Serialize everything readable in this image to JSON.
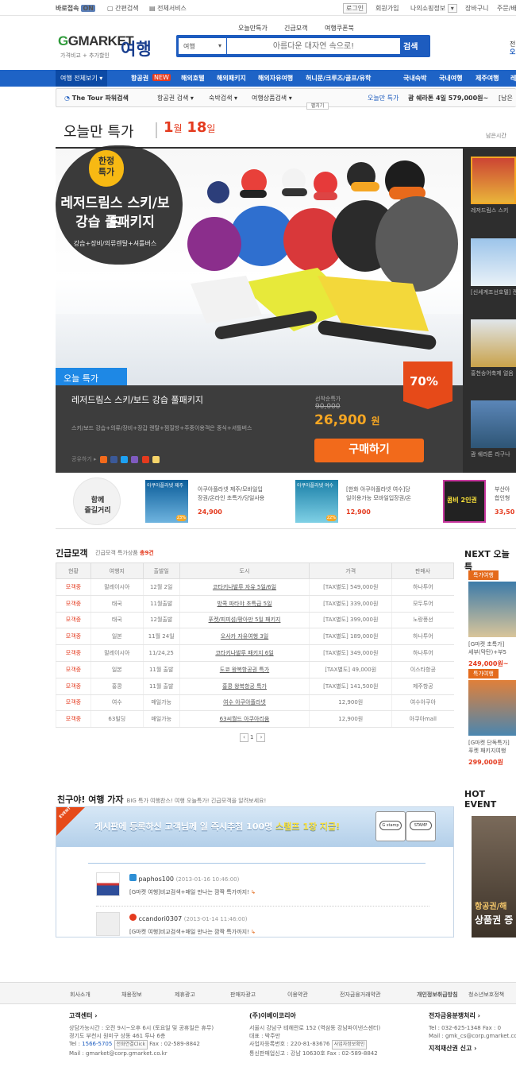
{
  "topbar": {
    "quick_access": "바로접속",
    "on_badge": "ON",
    "simple_search": "간편검색",
    "all_services": "전체서비스",
    "login": "로그인",
    "join": "회원가입",
    "my_shopping": "나의쇼핑정보",
    "cart": "장바구니",
    "order": "주문/배"
  },
  "header": {
    "logo_main": "GMARKET",
    "logo_sub": "가격비교 + 추가할인",
    "logo_travel": "여행",
    "links": [
      "오늘만특가",
      "긴급모객",
      "여행쿠폰북"
    ],
    "search_select": "여행",
    "search_placeholder": "아름다운 대자연 속으로!",
    "search_button": "검색",
    "right_cut": "전",
    "right_cut2": "오"
  },
  "nav": {
    "all_travel": "여행 전체보기",
    "items": [
      "항공권",
      "해외호텔",
      "해외패키지",
      "해외자유여행",
      "허니문/크루즈/골프/유학",
      "국내숙박",
      "국내여행",
      "제주여행",
      "레"
    ],
    "new_badge": "NEW"
  },
  "subnav": {
    "thetour": "The Tour 파워검색",
    "items": [
      "항공권 검색",
      "숙박검색",
      "여행상품검색"
    ],
    "today_label": "오늘만 특가",
    "today_deal": "괌 쉐라톤 4일 579,000원~",
    "today_tail": "[남은",
    "folder": "펼치기"
  },
  "today": {
    "title": "오늘만 특가",
    "month": "1",
    "month_unit": "월",
    "day": "18",
    "day_unit": "일",
    "remain": "남은시간"
  },
  "hero": {
    "badge_top": "한정",
    "badge_top2": "특가",
    "title1": "레저드림스 스키/보드",
    "title2": "강습 풀패키지",
    "tagline": "강습+장비/의류렌탈+셔틀버스",
    "tab": "오늘 특가",
    "discount": "70%",
    "name": "레저드림스 스키/보드 강습 풀패키지",
    "desc": "스키/보드 강습+의류/장비+장갑 렌탈+찜질방+주중이용객은 중식+셔틀버스",
    "share_label": "공유하기",
    "price_label": "선착순특가",
    "original_price": "90,000",
    "price": "26,900",
    "price_unit": "원",
    "buy": "구매하기"
  },
  "thumbs": [
    {
      "caption": "레저드림스 스키"
    },
    {
      "caption": "[신세계조선호텔] 켄"
    },
    {
      "caption": "홍천송어축제 얼음"
    },
    {
      "caption": "괌 쉐라톤 라구나"
    }
  ],
  "together": {
    "title1": "함께",
    "title2": "즐길거리",
    "items": [
      {
        "tag": "아쿠아플라넷 제주",
        "line1": "아쿠아플라넷 제주/모바일입",
        "line2": "장권/온라인 초특가/당일사용",
        "price": "24,900",
        "pct": "23%"
      },
      {
        "tag": "아쿠아플라넷 여수",
        "line1": "[한화 아쿠아플라넷 여수]당",
        "line2": "일이용가능 모바일입장권/온",
        "price": "12,900",
        "pct": "22%"
      },
      {
        "tag": "콤비 2인권",
        "line1": "부산아",
        "line2": "합인형",
        "price": "33,50",
        "pct": ""
      }
    ]
  },
  "urgent": {
    "title": "긴급모객",
    "subtitle": "긴급모객 특가상품",
    "total_prefix": "총",
    "total_count": "9건",
    "headers": [
      "현황",
      "여행지",
      "출발일",
      "도시",
      "가격",
      "판매사"
    ],
    "rows": [
      [
        "모객중",
        "말레이시아",
        "12월 2일",
        "코타키나발루 자유 5일/6일",
        "[TAX별도] 549,000원",
        "하나투어"
      ],
      [
        "모객중",
        "태국",
        "11월출발",
        "방콕 파타야 초특급 5일",
        "[TAX별도] 339,000원",
        "모두투어"
      ],
      [
        "모객중",
        "태국",
        "12월출발",
        "푸켓/피피섬/팡아만 5일 패키지",
        "[TAX별도] 399,000원",
        "노랑풍선"
      ],
      [
        "모객중",
        "일본",
        "11월 24일",
        "오사카 자유여행 3일",
        "[TAX별도] 189,000원",
        "하나투어"
      ],
      [
        "모객중",
        "말레이시아",
        "11/24,25",
        "코타키나발루 패키지 6일",
        "[TAX별도] 349,000원",
        "하나투어"
      ],
      [
        "모객중",
        "일본",
        "11월 출발",
        "도쿄 왕복항공권 특가",
        "[TAX별도] 49,000원",
        "이스타항공"
      ],
      [
        "모객중",
        "홍콩",
        "11월 출발",
        "홍콩 왕복항공 특가",
        "[TAX별도] 141,500원",
        "제주항공"
      ],
      [
        "모객중",
        "여수",
        "매일가능",
        "여수 아쿠아플라넷",
        "12,900원",
        "여수아쿠아"
      ],
      [
        "모객중",
        "63빌딩",
        "매일가능",
        "63씨월드 아쿠아리움",
        "12,900원",
        "아쿠아mall"
      ]
    ],
    "page": "1"
  },
  "next": {
    "title": "NEXT 오늘특",
    "items": [
      {
        "tag": "특가여행",
        "line1": "[G마켓 초특가]",
        "line2": "세부(막탄)+부5",
        "price": "249,000원~"
      },
      {
        "tag": "특가여행",
        "line1": "[G마켓 단독특가]",
        "line2": "푸켓 패키지여행",
        "price": "299,000원"
      }
    ]
  },
  "friend": {
    "title": "친구야! 여행 가자",
    "subtitle": "BIG 특가 여행찬스! 여행 오늘특가! 긴급모객을 알려보세요!",
    "event_tag": "EVENT",
    "banner_text": "게시판에 등록하신 고객님께 일 즉시추첨 100명",
    "banner_highlight": "스탬프 1장 지급!",
    "stamp1": "G stamp",
    "stamp2": "STAMP",
    "comments": [
      {
        "user": "paphos100",
        "time": "(2013-01-16 10:46:00)",
        "text": "[G마켓 여행]비교검색+매일 만나는 깜짝 특가까지!"
      },
      {
        "user": "ccandori0307",
        "time": "(2013-01-14 11:46:00)",
        "text": "[G마켓 여행]비교검색+매일 만나는 깜짝 특가까지!"
      }
    ]
  },
  "hot": {
    "title": "HOT EVENT",
    "line1": "항공권/해",
    "line2": "상품권 증"
  },
  "footer": {
    "links": [
      "회사소개",
      "채용정보",
      "제휴광고",
      "판매자광고",
      "이용약관",
      "전자금융거래약관",
      "개인정보취급방침",
      "청소년보호정책"
    ],
    "cs_title": "고객센터",
    "cs_hours": "상담가능시간 : 오전 9시~오후 6시 (토요일 및 공휴일은 휴무)",
    "cs_addr": "경기도 부천시 원미구 상동 461 투나 6층",
    "cs_tel_label": "Tel :",
    "cs_tel": "1566-5705",
    "cs_click": "전화연결Click",
    "cs_fax": "Fax : 02-589-8842",
    "cs_mail": "Mail : gmarket@corp.gmarket.co.kr",
    "co_title": "(주)이베이코리아",
    "co_addr": "서울시 강남구 테헤란로 152 (역삼동 강남파이낸스센터)",
    "co_ceo": "대표 : 박주만",
    "co_biz": "사업자등록번호 : 220-81-83676",
    "co_biz_btn": "사업자정보확인",
    "co_tel": "통신판매업신고 : 강남 10630호  Fax : 02-589-8842",
    "ef_title": "전자금융분쟁처리",
    "ef_tel": "Tel : 032-625-1348  Fax : 0",
    "ef_mail": "Mail : gmk_cs@corp.gmarket.com",
    "ef_report": "지적재산권 신고"
  },
  "colors": {
    "brand_blue": "#1e63c6",
    "accent_red": "#e43a1e",
    "price_orange": "#f5a623",
    "buy_orange": "#f26a1b"
  }
}
